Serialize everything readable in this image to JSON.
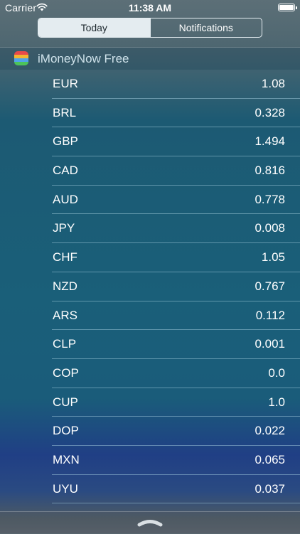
{
  "status_bar": {
    "carrier": "Carrier",
    "time": "11:38 AM"
  },
  "segmented_control": {
    "today_label": "Today",
    "notifications_label": "Notifications",
    "selected": "Today"
  },
  "widget": {
    "title": "iMoneyNow Free",
    "icon_colors": [
      "#e84a4a",
      "#f2b531",
      "#4fa3e8",
      "#4cc35a"
    ],
    "rates": [
      {
        "code": "EUR",
        "value": "1.08"
      },
      {
        "code": "BRL",
        "value": "0.328"
      },
      {
        "code": "GBP",
        "value": "1.494"
      },
      {
        "code": "CAD",
        "value": "0.816"
      },
      {
        "code": "AUD",
        "value": "0.778"
      },
      {
        "code": "JPY",
        "value": "0.008"
      },
      {
        "code": "CHF",
        "value": "1.05"
      },
      {
        "code": "NZD",
        "value": "0.767"
      },
      {
        "code": "ARS",
        "value": "0.112"
      },
      {
        "code": "CLP",
        "value": "0.001"
      },
      {
        "code": "COP",
        "value": "0.0"
      },
      {
        "code": "CUP",
        "value": "1.0"
      },
      {
        "code": "DOP",
        "value": "0.022"
      },
      {
        "code": "MXN",
        "value": "0.065"
      },
      {
        "code": "UYU",
        "value": "0.037"
      }
    ]
  }
}
